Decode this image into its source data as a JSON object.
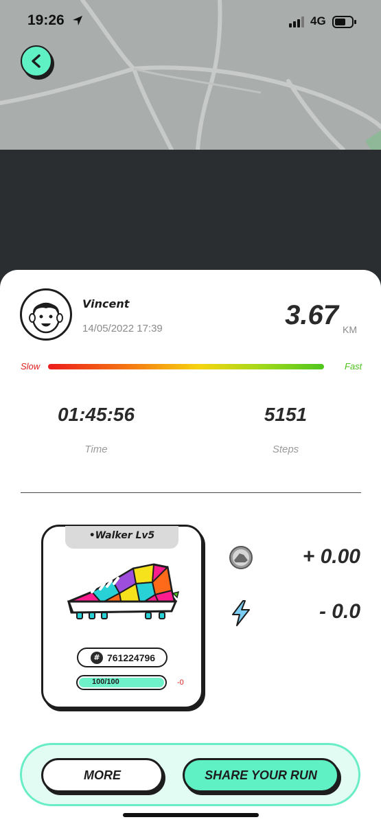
{
  "status_bar": {
    "time": "19:26",
    "network": "4G",
    "icons": [
      "location-arrow-icon",
      "signal-icon",
      "battery-icon"
    ]
  },
  "nav": {
    "back_icon": "chevron-left-icon"
  },
  "run": {
    "username": "Vincent",
    "datetime": "14/05/2022 17:39",
    "distance": "3.67",
    "distance_unit": "KM",
    "speed_slow_label": "Slow",
    "speed_fast_label": "Fast",
    "duration": "01:45:56",
    "duration_label": "Time",
    "steps": "5151",
    "steps_label": "Steps"
  },
  "shoe": {
    "level": "Walker Lv5",
    "id": "761224796",
    "durability_text": "100/100",
    "durability_fraction": 1.0,
    "durability_delta": "-0"
  },
  "rewards": {
    "earned": "+ 0.00",
    "energy": "- 0.0"
  },
  "buttons": {
    "more": "MORE",
    "share": "SHARE YOUR RUN"
  },
  "colors": {
    "accent": "#5ff0c4",
    "slow": "#e02020",
    "fast": "#4cc21d"
  }
}
